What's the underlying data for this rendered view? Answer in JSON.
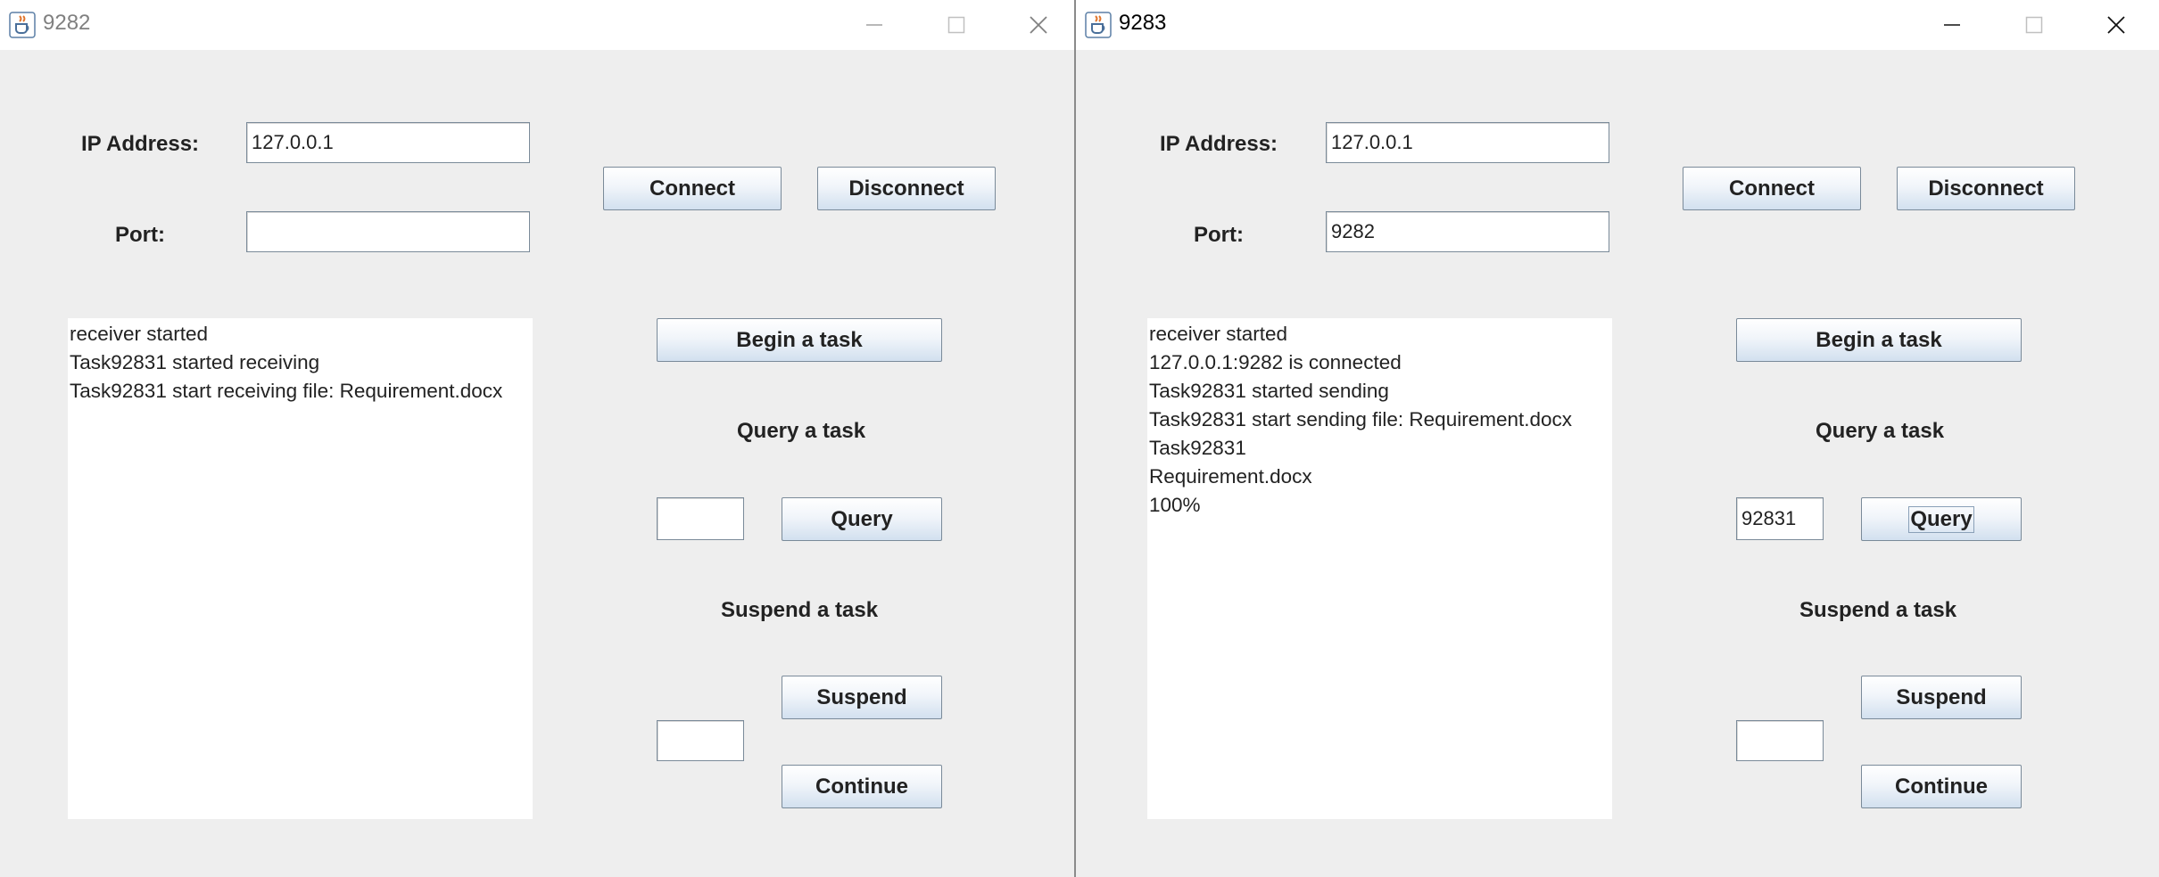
{
  "windows": [
    {
      "title": "9282",
      "title_active": false,
      "ip_label": "IP Address:",
      "ip_value": "127.0.0.1",
      "port_label": "Port:",
      "port_value": "",
      "connect_label": "Connect",
      "disconnect_label": "Disconnect",
      "begin_label": "Begin a task",
      "query_title": "Query a task",
      "query_input": "",
      "query_label": "Query",
      "suspend_title": "Suspend a task",
      "suspend_input": "",
      "suspend_label": "Suspend",
      "continue_label": "Continue",
      "log": [
        "receiver started",
        "Task92831 started receiving",
        "Task92831 start receiving file: Requirement.docx"
      ]
    },
    {
      "title": "9283",
      "title_active": true,
      "ip_label": "IP Address:",
      "ip_value": "127.0.0.1",
      "port_label": "Port:",
      "port_value": "9282",
      "connect_label": "Connect",
      "disconnect_label": "Disconnect",
      "begin_label": "Begin a task",
      "query_title": "Query a task",
      "query_input": "92831",
      "query_label": "Query",
      "suspend_title": "Suspend a task",
      "suspend_input": "",
      "suspend_label": "Suspend",
      "continue_label": "Continue",
      "log": [
        "receiver started",
        "127.0.0.1:9282 is connected",
        "Task92831 started sending",
        "Task92831 start sending file: Requirement.docx",
        "Task92831",
        "Requirement.docx",
        "100%"
      ]
    }
  ],
  "icons": {
    "app_icon": "java-coffee-cup-icon",
    "minimize": "minimize-icon",
    "maximize": "maximize-icon",
    "close": "close-icon"
  }
}
